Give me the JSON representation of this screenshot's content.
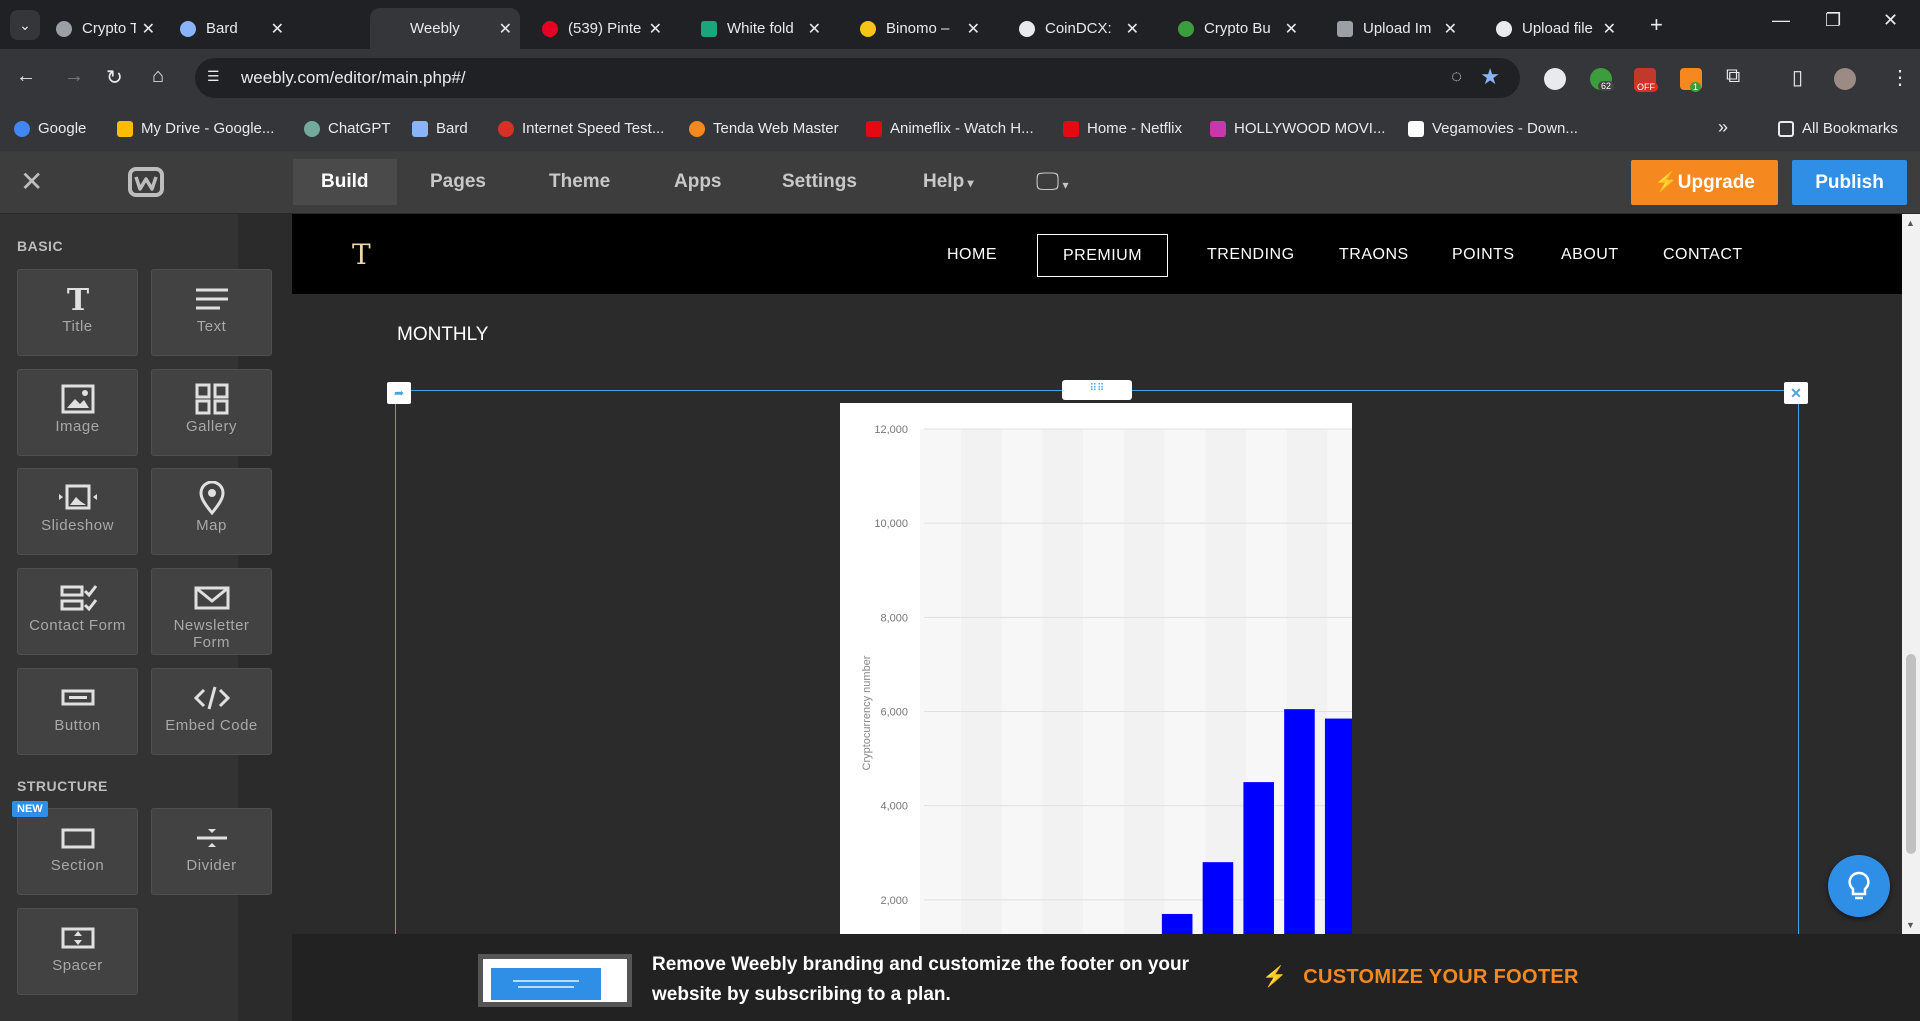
{
  "browser": {
    "tabs": [
      {
        "title": "Crypto Tre",
        "favicon_color": "#9aa0a6"
      },
      {
        "title": "Bard",
        "favicon_color": "#8ab4f8"
      },
      {
        "title": "Weebly",
        "favicon_color": "#35363a",
        "active": true
      },
      {
        "title": "(539) Pinte",
        "favicon_color": "#e60023"
      },
      {
        "title": "White fold",
        "favicon_color": "#1aa57c"
      },
      {
        "title": "Binomo – ",
        "favicon_color": "#f5c518"
      },
      {
        "title": "CoinDCX: ",
        "favicon_color": "#e8eaed"
      },
      {
        "title": "Crypto Bu",
        "favicon_color": "#3c9d3c"
      },
      {
        "title": "Upload Im",
        "favicon_color": "#9aa0a6"
      },
      {
        "title": "Upload file",
        "favicon_color": "#e8eaed"
      }
    ],
    "url": "weebly.com/editor/main.php#/",
    "ext_badges": {
      "count": "62",
      "off": "OFF",
      "one": "1"
    },
    "bookmarks": [
      {
        "label": "Google",
        "color": "#4285f4"
      },
      {
        "label": "My Drive - Google...",
        "color": "#fbbc04"
      },
      {
        "label": "ChatGPT",
        "color": "#74aa9c"
      },
      {
        "label": "Bard",
        "color": "#8ab4f8"
      },
      {
        "label": "Internet Speed Test...",
        "color": "#d93025"
      },
      {
        "label": "Tenda Web Master",
        "color": "#f5891f"
      },
      {
        "label": "Animeflix - Watch H...",
        "color": "#e50914"
      },
      {
        "label": "Home - Netflix",
        "color": "#e50914"
      },
      {
        "label": "HOLLYWOOD MOVI...",
        "color": "#c837ab"
      },
      {
        "label": "Vegamovies - Down...",
        "color": "#ffffff"
      }
    ],
    "all_bookmarks": "All Bookmarks"
  },
  "editor": {
    "tabs": [
      "Build",
      "Pages",
      "Theme",
      "Apps",
      "Settings",
      "Help"
    ],
    "upgrade": "Upgrade",
    "publish": "Publish"
  },
  "sidebar": {
    "basic_title": "BASIC",
    "structure_title": "STRUCTURE",
    "new_badge": "NEW",
    "basic": [
      {
        "label": "Title",
        "icon": "title-icon"
      },
      {
        "label": "Text",
        "icon": "text-icon"
      },
      {
        "label": "Image",
        "icon": "image-icon"
      },
      {
        "label": "Gallery",
        "icon": "gallery-icon"
      },
      {
        "label": "Slideshow",
        "icon": "slideshow-icon"
      },
      {
        "label": "Map",
        "icon": "map-pin-icon"
      },
      {
        "label": "Contact Form",
        "icon": "contact-form-icon"
      },
      {
        "label": "Newsletter Form",
        "icon": "envelope-icon"
      },
      {
        "label": "Button",
        "icon": "button-icon"
      },
      {
        "label": "Embed Code",
        "icon": "code-icon"
      }
    ],
    "structure": [
      {
        "label": "Section",
        "icon": "section-icon"
      },
      {
        "label": "Divider",
        "icon": "divider-icon"
      },
      {
        "label": "Spacer",
        "icon": "spacer-icon"
      }
    ]
  },
  "site": {
    "logo": "T",
    "nav": [
      "HOME",
      "PREMIUM",
      "TRENDING",
      "TRAONS",
      "POINTS",
      "ABOUT",
      "CONTACT"
    ],
    "active_nav": "PREMIUM",
    "heading": "MONTHLY"
  },
  "chart_data": {
    "type": "bar",
    "ylabel": "Cryptocurrency number",
    "ylim": [
      0,
      12000
    ],
    "yticks": [
      "2,000",
      "4,000",
      "6,000",
      "8,000",
      "10,000",
      "12,000"
    ],
    "values": [
      0,
      0,
      0,
      0,
      0,
      1700,
      2800,
      4500,
      6050,
      5850
    ],
    "bar_color": "#0000ff"
  },
  "footer": {
    "message": "Remove Weebly branding and customize the footer on your website by subscribing to a plan.",
    "cta": "CUSTOMIZE YOUR FOOTER"
  }
}
